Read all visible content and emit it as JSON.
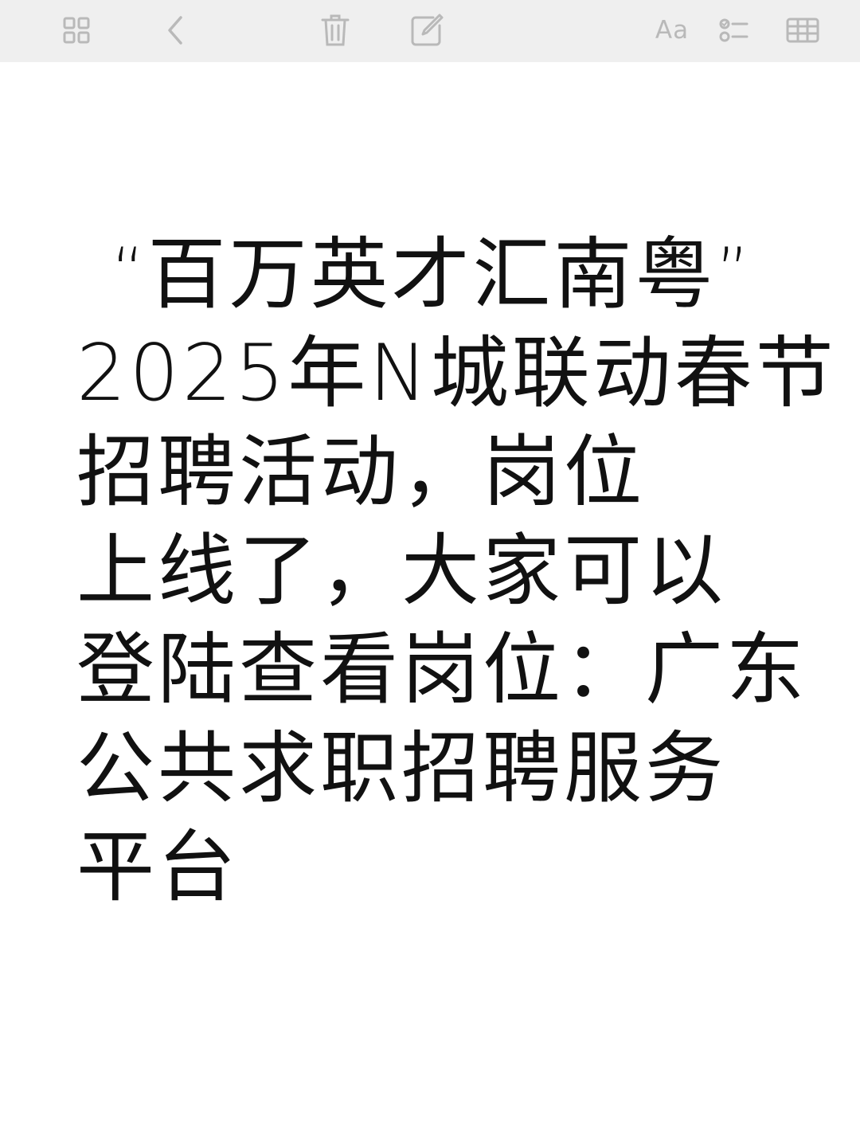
{
  "toolbar": {
    "icons": [
      "grid-icon",
      "back-chevron-icon",
      "trash-icon",
      "compose-icon",
      "format-text-icon",
      "checklist-icon",
      "table-icon"
    ],
    "format_label": "Aa"
  },
  "note": {
    "line1": {
      "open_quote": "“",
      "highlight": "百万英才汇南粤",
      "close_quote": "”"
    },
    "line2": {
      "plain": "2025年N城联动",
      "highlight": "春节"
    },
    "line3": {
      "highlight1": "招聘活动",
      "plain": "，",
      "highlight2": "岗位"
    },
    "line4": {
      "highlight": "上线",
      "plain": "了，大家可以"
    },
    "line5": "登陆查看岗位：广东",
    "line6": "公共求职招聘服务",
    "line7": "平台"
  },
  "colors": {
    "toolbar_bg": "#efefef",
    "icon": "#b9b9b9",
    "highlight_purple": "#efb3f8",
    "highlight_red": "#f56e6c",
    "text": "#111111"
  }
}
